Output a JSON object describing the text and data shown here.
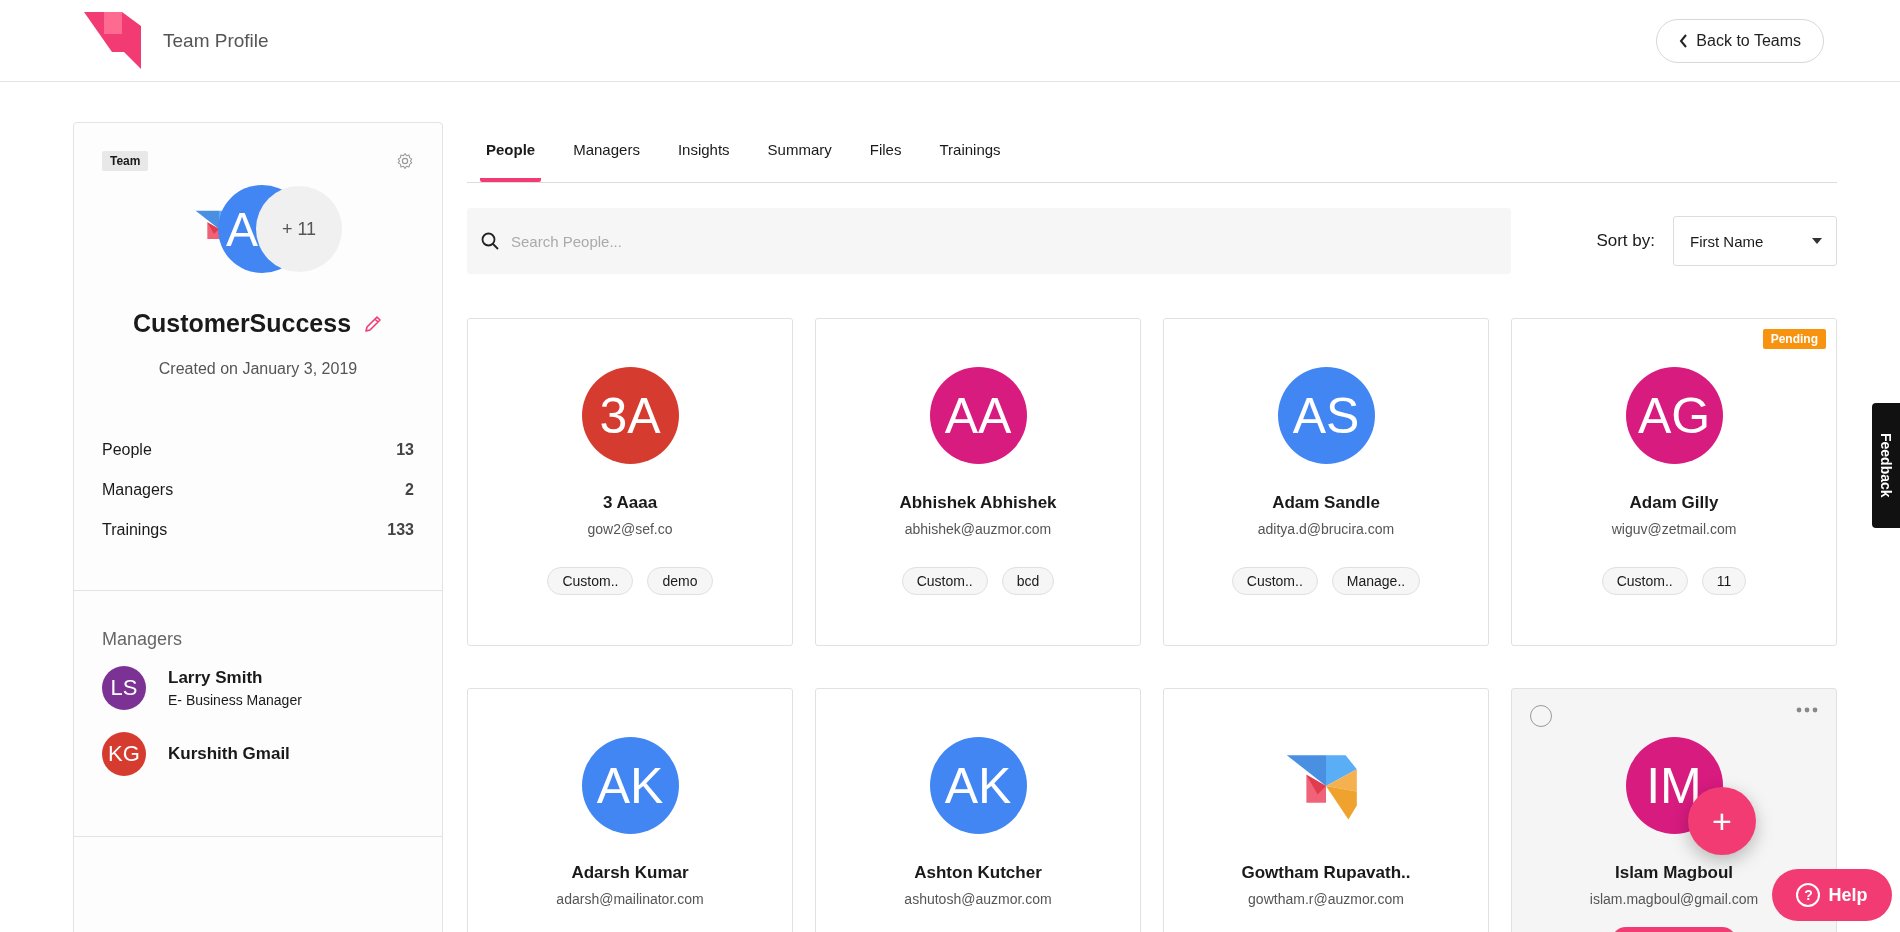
{
  "header": {
    "title": "Team Profile",
    "back_button": "Back to Teams"
  },
  "team": {
    "badge": "Team",
    "avatar_initial": "A",
    "more_count": "+ 11",
    "name": "CustomerSuccess",
    "created": "Created on January 3, 2019",
    "stats": [
      {
        "label": "People",
        "value": "13"
      },
      {
        "label": "Managers",
        "value": "2"
      },
      {
        "label": "Trainings",
        "value": "133"
      }
    ],
    "managers_title": "Managers",
    "managers": [
      {
        "initials": "LS",
        "name": "Larry Smith",
        "role": "E- Business Manager",
        "color": "#7b3294"
      },
      {
        "initials": "KG",
        "name": "Kurshith Gmail",
        "color": "#d63b2f"
      }
    ]
  },
  "tabs": [
    {
      "label": "People",
      "selected": true
    },
    {
      "label": "Managers",
      "selected": false
    },
    {
      "label": "Insights",
      "selected": false
    },
    {
      "label": "Summary",
      "selected": false
    },
    {
      "label": "Files",
      "selected": false
    },
    {
      "label": "Trainings",
      "selected": false
    }
  ],
  "search": {
    "placeholder": "Search People..."
  },
  "sort": {
    "label": "Sort by:",
    "value": "First Name"
  },
  "people": [
    {
      "kind": "initials",
      "initials": "3A",
      "color": "#d63b2f",
      "name": "3 Aaaa",
      "email": "gow2@sef.co",
      "tags": [
        "Custom..",
        "demo"
      ],
      "pending": false,
      "highlighted": false
    },
    {
      "kind": "initials",
      "initials": "AA",
      "color": "#d81b7f",
      "name": "Abhishek Abhishek",
      "email": "abhishek@auzmor.com",
      "tags": [
        "Custom..",
        "bcd"
      ],
      "pending": false,
      "highlighted": false
    },
    {
      "kind": "initials",
      "initials": "AS",
      "color": "#4286f4",
      "name": "Adam Sandle",
      "email": "aditya.d@brucira.com",
      "tags": [
        "Custom..",
        "Manage.."
      ],
      "pending": false,
      "highlighted": false
    },
    {
      "kind": "initials",
      "initials": "AG",
      "color": "#d81b7f",
      "name": "Adam Gilly",
      "email": "wiguv@zetmail.com",
      "tags": [
        "Custom..",
        "11"
      ],
      "pending": true,
      "badge": "Pending",
      "highlighted": false
    },
    {
      "kind": "initials",
      "initials": "AK",
      "color": "#4286f4",
      "name": "Adarsh Kumar",
      "email": "adarsh@mailinator.com",
      "pending": false,
      "highlighted": false
    },
    {
      "kind": "initials",
      "initials": "AK",
      "color": "#4286f4",
      "name": "Ashton Kutcher",
      "email": "ashutosh@auzmor.com",
      "pending": false,
      "highlighted": false
    },
    {
      "kind": "logo",
      "name": "Gowtham Rupavath..",
      "email": "gowtham.r@auzmor.com",
      "pending": false,
      "highlighted": false
    },
    {
      "kind": "initials",
      "initials": "IM",
      "color": "#d81b7f",
      "name": "Islam Magboul",
      "email": "islam.magboul@gmail.com",
      "pending": false,
      "highlighted": true
    }
  ],
  "fab": "+",
  "feedback": "Feedback",
  "help": {
    "icon": "?",
    "label": "Help"
  }
}
